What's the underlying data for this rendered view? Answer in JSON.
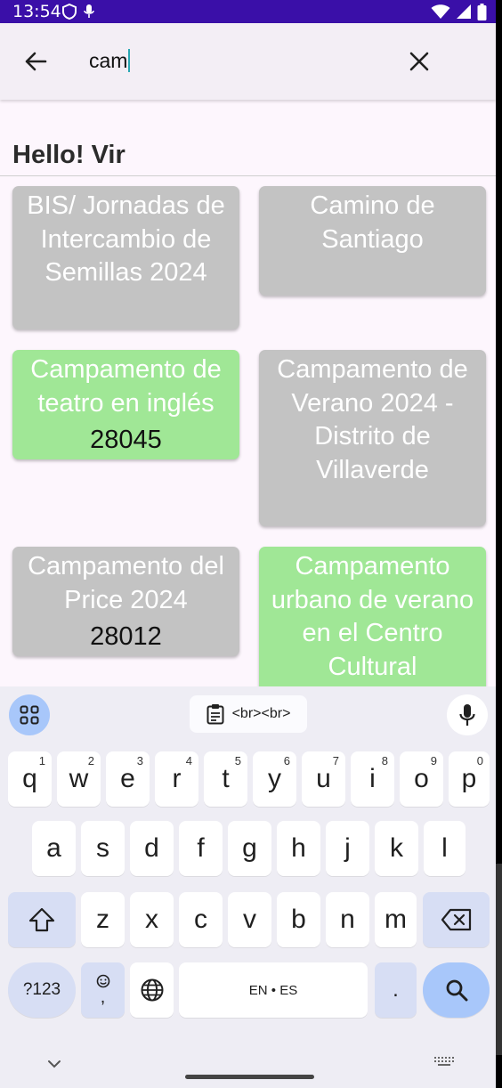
{
  "status_bar": {
    "time": "13:54",
    "icons": [
      "shield-icon",
      "mic-icon",
      "wifi-icon",
      "signal-icon",
      "battery-icon"
    ]
  },
  "search": {
    "query": "cam",
    "back_icon": "arrow-left-icon",
    "clear_icon": "close-icon"
  },
  "greeting": "Hello! Vir",
  "cards": [
    {
      "title": "BIS/ Jornadas de Intercambio de Semillas 2024",
      "postal_code": "",
      "color": "#c3c3c3"
    },
    {
      "title": "Camino de Santiago",
      "postal_code": "",
      "color": "#c3c3c3"
    },
    {
      "title": "Campamento de teatro en inglés",
      "postal_code": "28045",
      "color": "#a0e796"
    },
    {
      "title": "Campamento de Verano 2024 -  Distrito de Villaverde",
      "postal_code": "",
      "color": "#c3c3c3"
    },
    {
      "title": "Campamento del Price 2024",
      "postal_code": "28012",
      "color": "#c3c3c3"
    },
    {
      "title": "Campamento urbano de verano en el Centro Cultural",
      "postal_code": "",
      "color": "#a0e796"
    }
  ],
  "keyboard": {
    "clipboard_suggestion": "<br><br>",
    "row1": [
      {
        "key": "q",
        "hint": "1"
      },
      {
        "key": "w",
        "hint": "2"
      },
      {
        "key": "e",
        "hint": "3"
      },
      {
        "key": "r",
        "hint": "4"
      },
      {
        "key": "t",
        "hint": "5"
      },
      {
        "key": "y",
        "hint": "6"
      },
      {
        "key": "u",
        "hint": "7"
      },
      {
        "key": "i",
        "hint": "8"
      },
      {
        "key": "o",
        "hint": "9"
      },
      {
        "key": "p",
        "hint": "0"
      }
    ],
    "row2": [
      "a",
      "s",
      "d",
      "f",
      "g",
      "h",
      "j",
      "k",
      "l"
    ],
    "row3": [
      "z",
      "x",
      "c",
      "v",
      "b",
      "n",
      "m"
    ],
    "symbols_label": "?123",
    "emoji_comma_label": ",",
    "space_label": "EN • ES",
    "period_label": "."
  }
}
